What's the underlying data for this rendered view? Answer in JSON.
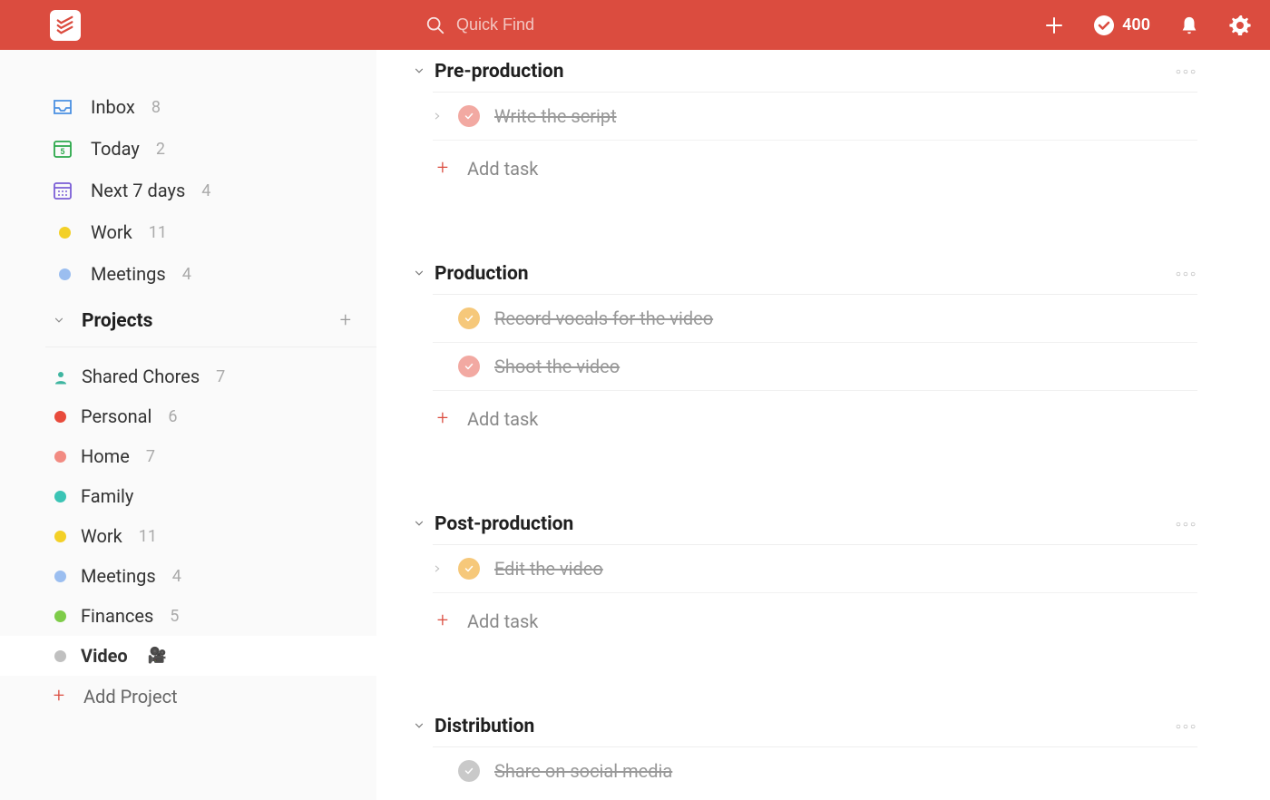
{
  "header": {
    "search_placeholder": "Quick Find",
    "productivity_score": "400"
  },
  "sidebar": {
    "nav": [
      {
        "label": "Inbox",
        "count": "8"
      },
      {
        "label": "Today",
        "count": "2"
      },
      {
        "label": "Next 7 days",
        "count": "4"
      },
      {
        "label": "Work",
        "count": "11"
      },
      {
        "label": "Meetings",
        "count": "4"
      }
    ],
    "projects_label": "Projects",
    "projects": [
      {
        "label": "Shared Chores",
        "count": "7",
        "color": "#3eb5a0",
        "shared": true
      },
      {
        "label": "Personal",
        "count": "6",
        "color": "#e84b3c",
        "shared": false
      },
      {
        "label": "Home",
        "count": "7",
        "color": "#f28b82",
        "shared": false
      },
      {
        "label": "Family",
        "count": "",
        "color": "#3bc4b5",
        "shared": false
      },
      {
        "label": "Work",
        "count": "11",
        "color": "#f3d027",
        "shared": false
      },
      {
        "label": "Meetings",
        "count": "4",
        "color": "#9bbef0",
        "shared": false
      },
      {
        "label": "Finances",
        "count": "5",
        "color": "#7ecc49",
        "shared": false
      },
      {
        "label": "Video",
        "count": "",
        "color": "#c0c0c0",
        "shared": false,
        "emoji": "🎥",
        "active": true
      }
    ],
    "add_project_label": "Add Project"
  },
  "main": {
    "add_task_label": "Add task",
    "sections": [
      {
        "title": "Pre-production",
        "tasks": [
          {
            "name": "Write the script",
            "check_color": "#f2a9a2",
            "has_subtasks": true
          }
        ]
      },
      {
        "title": "Production",
        "tasks": [
          {
            "name": "Record vocals for the video",
            "check_color": "#f6c87a",
            "has_subtasks": false
          },
          {
            "name": "Shoot the video",
            "check_color": "#f2a9a2",
            "has_subtasks": false
          }
        ]
      },
      {
        "title": "Post-production",
        "tasks": [
          {
            "name": "Edit the video",
            "check_color": "#f6c87a",
            "has_subtasks": true
          }
        ]
      },
      {
        "title": "Distribution",
        "tasks": [
          {
            "name": "Share on social media",
            "check_color": "#c9c9c9",
            "has_subtasks": false
          }
        ]
      }
    ]
  },
  "colors": {
    "salmon": "#f2a9a2",
    "amber": "#f6c87a",
    "grey": "#c9c9c9"
  }
}
